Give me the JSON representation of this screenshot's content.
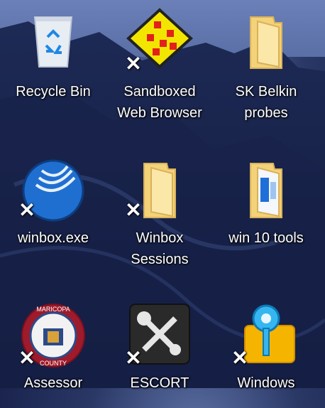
{
  "desktop": {
    "icons": [
      {
        "label": "Recycle Bin",
        "icon": "recycle-bin-icon",
        "shortcut": false
      },
      {
        "label": "Sandboxed\nWeb Browser",
        "icon": "sandbox-icon",
        "shortcut": true
      },
      {
        "label": "SK Belkin\nprobes",
        "icon": "folder-icon",
        "shortcut": false
      },
      {
        "label": "winbox.exe",
        "icon": "winbox-icon",
        "shortcut": true
      },
      {
        "label": "Winbox\nSessions",
        "icon": "folder-icon",
        "shortcut": true
      },
      {
        "label": "win 10 tools",
        "icon": "folder-icon",
        "shortcut": false
      },
      {
        "label": "Assessor",
        "icon": "maricopa-county-seal-icon",
        "shortcut": true
      },
      {
        "label": "ESCORT",
        "icon": "wrench-screwdriver-icon",
        "shortcut": true
      },
      {
        "label": "Windows",
        "icon": "map-pin-icon",
        "shortcut": true
      }
    ]
  },
  "seal": {
    "top_text": "MARICOPA",
    "bottom_text": "COUNTY"
  },
  "colors": {
    "folder": "#f3d27a",
    "sandbox": "#f2e600",
    "winbox": "#1f6fd0",
    "pin": "#35b6f0"
  }
}
